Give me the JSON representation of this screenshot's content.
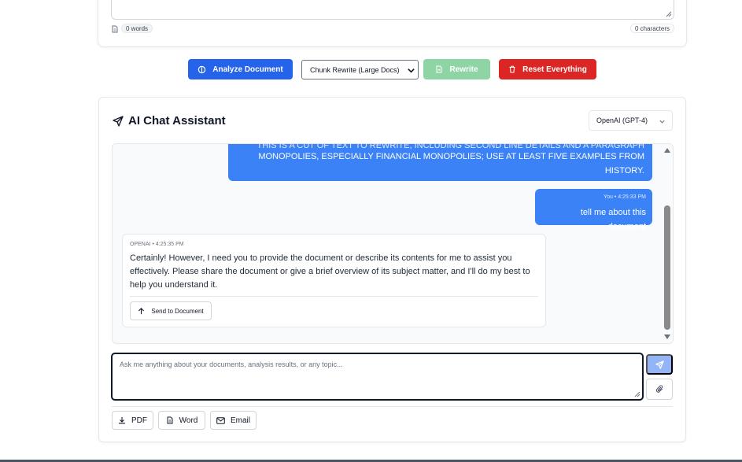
{
  "editor": {
    "word_count": "0 words",
    "char_count": "0 characters"
  },
  "actions": {
    "analyze_label": "Analyze Document",
    "mode_selected": "Chunk Rewrite (Large Docs)",
    "rewrite_label": "Rewrite",
    "reset_label": "Reset Everything"
  },
  "chat": {
    "title": "AI Chat Assistant",
    "model_selected": "OpenAI (GPT-4)",
    "messages": [
      {
        "role": "user",
        "text_cut": "THIS IS A CUT OF TEXT TO REWRITE, INCLUDING SECOND LINE DETAILS AND A PARAGRAPH WITH",
        "text": "MONOPOLIES, ESPECIALLY FINANCIAL MONOPOLIES; USE AT LEAST FIVE EXAMPLES FROM HISTORY."
      },
      {
        "role": "user",
        "meta": "You • 4:25:33 PM",
        "text": "tell me about this document"
      },
      {
        "role": "assistant",
        "meta": "OPENAI • 4:25:35 PM",
        "text": "Certainly! However, I need you to provide the document or describe its contents for me to assist you effectively. Please share the document or give a brief overview of its subject matter, and I'll do my best to help you understand it.",
        "send_label": "Send to Document"
      }
    ],
    "input_placeholder": "Ask me anything about your documents, analysis results, or any topic...",
    "export": {
      "pdf_label": "PDF",
      "word_label": "Word",
      "email_label": "Email"
    }
  },
  "colors": {
    "primary": "#2563eb",
    "user_bubble": "#3b82f6",
    "rewrite_disabled": "#8fd4a4",
    "reset": "#dc2626"
  },
  "icons": [
    "document-icon",
    "analyze-icon",
    "chevron-down-icon",
    "rewrite-doc-icon",
    "trash-icon",
    "send-icon",
    "arrow-up-icon",
    "paperclip-icon",
    "download-icon",
    "word-file-icon",
    "mail-icon"
  ]
}
